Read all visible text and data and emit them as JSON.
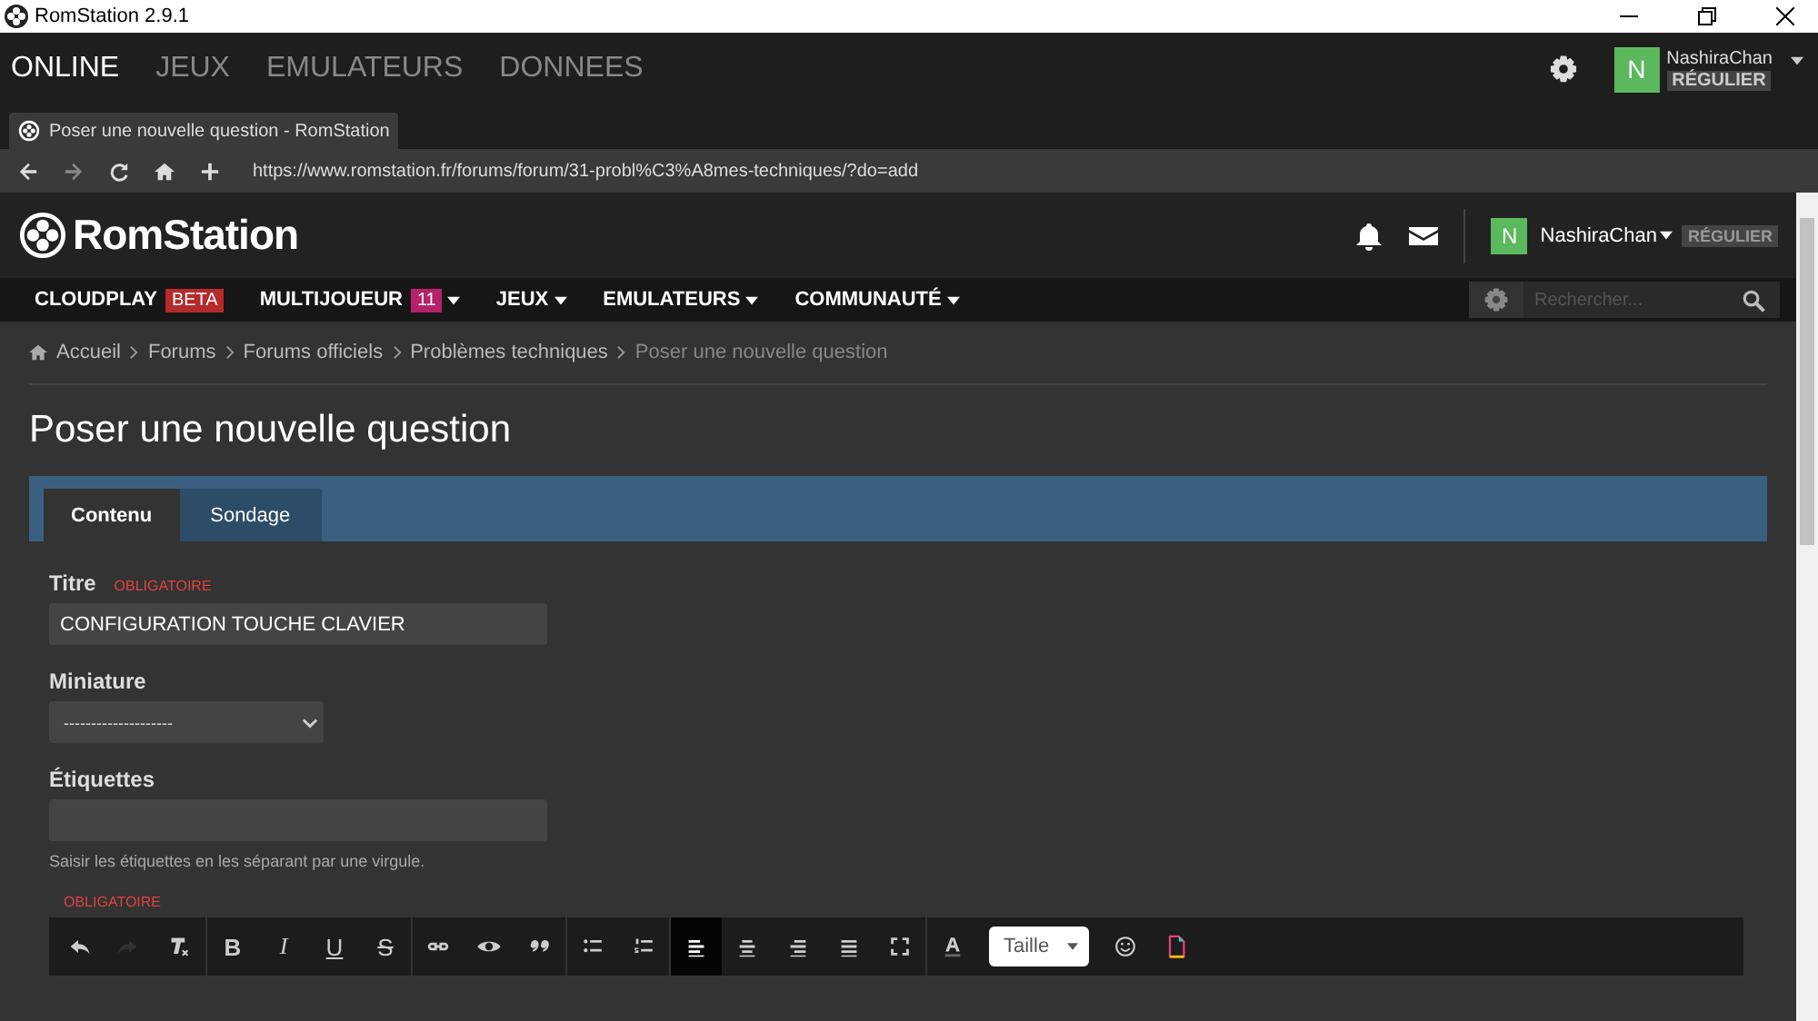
{
  "window": {
    "title": "RomStation 2.9.1"
  },
  "app_nav": [
    {
      "label": "ONLINE",
      "selected": true
    },
    {
      "label": "JEUX",
      "selected": false
    },
    {
      "label": "EMULATEURS",
      "selected": false
    },
    {
      "label": "DONNEES",
      "selected": false
    }
  ],
  "app_user": {
    "initial": "N",
    "name": "NashiraChan",
    "rank": "RÉGULIER"
  },
  "browser_tab": {
    "title": "Poser une nouvelle question - RomStation"
  },
  "address": {
    "url": "https://www.romstation.fr/forums/forum/31-probl%C3%A8mes-techniques/?do=add"
  },
  "site": {
    "logo": "RomStation",
    "user_initial": "N",
    "user_name": "NashiraChan",
    "rank": "RÉGULIER"
  },
  "site_nav": [
    {
      "label": "CLOUDPLAY",
      "badge": "BETA",
      "kind": "beta",
      "menu": false
    },
    {
      "label": "MULTIJOUEUR",
      "badge": "11",
      "kind": "count",
      "menu": true
    },
    {
      "label": "JEUX",
      "kind": "plain",
      "menu": true
    },
    {
      "label": "EMULATEURS",
      "kind": "plain",
      "menu": true
    },
    {
      "label": "COMMUNAUTÉ",
      "kind": "plain",
      "menu": true
    }
  ],
  "search": {
    "placeholder": "Rechercher..."
  },
  "breadcrumb": [
    {
      "label": "Accueil",
      "current": false
    },
    {
      "label": "Forums",
      "current": false
    },
    {
      "label": "Forums officiels",
      "current": false
    },
    {
      "label": "Problèmes techniques",
      "current": false
    },
    {
      "label": "Poser une nouvelle question",
      "current": true
    }
  ],
  "page_title": "Poser une nouvelle question",
  "form_tabs": [
    {
      "label": "Contenu",
      "selected": true
    },
    {
      "label": "Sondage",
      "selected": false
    }
  ],
  "fields": [
    {
      "kind": "text",
      "label": "Titre",
      "required": "OBLIGATOIRE",
      "value": "CONFIGURATION TOUCHE CLAVIER"
    },
    {
      "kind": "select",
      "label": "Miniature",
      "value": "--------------------"
    },
    {
      "kind": "text",
      "label": "Étiquettes",
      "hint": "Saisir les étiquettes en les séparant par une virgule."
    },
    {
      "kind": "editor",
      "required": "OBLIGATOIRE"
    }
  ],
  "toolbar": [
    {
      "buttons": [
        {
          "kind": "undo",
          "disabled": false,
          "selected": false
        },
        {
          "kind": "redo",
          "disabled": true,
          "selected": false
        },
        {
          "kind": "clear",
          "disabled": false,
          "selected": false
        }
      ]
    },
    {
      "buttons": [
        {
          "kind": "bold",
          "label": "B",
          "disabled": false,
          "selected": false
        },
        {
          "kind": "italic",
          "label": "I",
          "disabled": false,
          "selected": false
        },
        {
          "kind": "underline",
          "label": "U",
          "disabled": false,
          "selected": false
        },
        {
          "kind": "strike",
          "label": "S",
          "disabled": false,
          "selected": false
        }
      ]
    },
    {
      "buttons": [
        {
          "kind": "link",
          "disabled": false,
          "selected": false
        },
        {
          "kind": "preview",
          "disabled": false,
          "selected": false
        },
        {
          "kind": "quote",
          "disabled": false,
          "selected": false
        }
      ]
    },
    {
      "buttons": [
        {
          "kind": "bullets",
          "disabled": false,
          "selected": false
        },
        {
          "kind": "numbers",
          "disabled": false,
          "selected": false
        }
      ]
    },
    {
      "buttons": [
        {
          "kind": "align-left",
          "disabled": false,
          "selected": true
        },
        {
          "kind": "align-center",
          "disabled": false,
          "selected": false
        },
        {
          "kind": "align-right",
          "disabled": false,
          "selected": false
        },
        {
          "kind": "justify",
          "disabled": false,
          "selected": false
        },
        {
          "kind": "fullscreen",
          "disabled": false,
          "selected": false
        }
      ]
    },
    {
      "buttons": [
        {
          "kind": "color",
          "disabled": false,
          "selected": false
        },
        {
          "kind": "size",
          "label": "Taille",
          "disabled": false,
          "selected": false
        },
        {
          "kind": "emoji",
          "disabled": false,
          "selected": false
        },
        {
          "kind": "file",
          "disabled": false,
          "selected": false
        }
      ]
    }
  ]
}
